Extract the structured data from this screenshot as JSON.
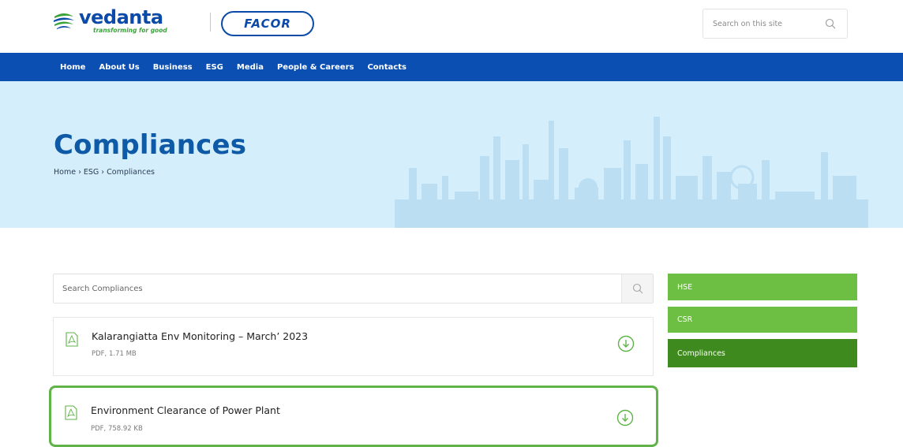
{
  "header": {
    "logo_word": "vedanta",
    "logo_tagline": "transforming for good",
    "partner_logo": "FACOR",
    "search": {
      "placeholder": "Search on this site",
      "icon": "search-icon"
    }
  },
  "nav": {
    "items": [
      "Home",
      "About Us",
      "Business",
      "ESG",
      "Media",
      "People & Careers",
      "Contacts"
    ]
  },
  "banner": {
    "title": "Compliances",
    "breadcrumb": "Home › ESG › Compliances"
  },
  "compliances": {
    "search_placeholder": "Search Compliances",
    "documents": [
      {
        "title": "Kalarangiatta Env Monitoring – March’ 2023",
        "meta": "PDF, 1.71 MB"
      },
      {
        "title": "Environment Clearance of Power Plant",
        "meta": "PDF, 758.92 KB"
      }
    ]
  },
  "sidebar": {
    "items": [
      "HSE",
      "CSR",
      "Compliances"
    ],
    "active": "Compliances"
  },
  "colors": {
    "brand_blue": "#0a4fb1",
    "title_blue": "#0e5aa6",
    "banner_bg": "#d4eefb",
    "green": "#6cbf42",
    "green_active": "#3f8a1e",
    "highlight_border": "#5fb348"
  }
}
